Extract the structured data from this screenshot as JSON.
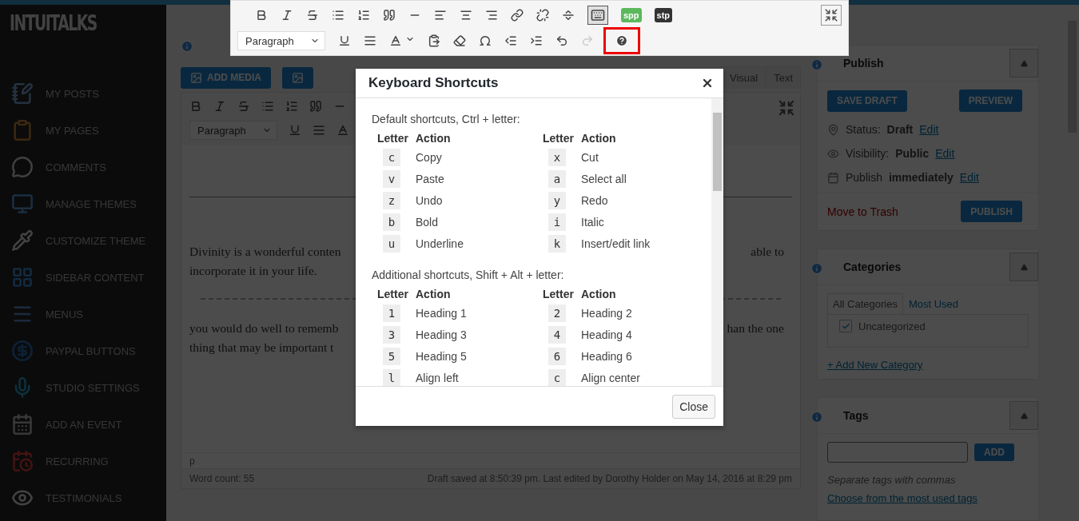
{
  "logo": "INTUITALKS",
  "sidebar": {
    "items": [
      {
        "label": "MY POSTS"
      },
      {
        "label": "MY PAGES"
      },
      {
        "label": "COMMENTS"
      },
      {
        "label": "MANAGE THEMES"
      },
      {
        "label": "CUSTOMIZE THEME"
      },
      {
        "label": "SIDEBAR CONTENT"
      },
      {
        "label": "MENUS"
      },
      {
        "label": "PAYPAL BUTTONS"
      },
      {
        "label": "STUDIO SETTINGS"
      },
      {
        "label": "ADD AN EVENT"
      },
      {
        "label": "RECURRING"
      },
      {
        "label": "TESTIMONIALS"
      }
    ]
  },
  "editor": {
    "add_media": "ADD MEDIA",
    "tabs": [
      {
        "label": "Visual"
      },
      {
        "label": "Text"
      }
    ],
    "format_select": "Paragraph",
    "paragraphs": [
      {
        "left": [
          "Divinity is a wonderful conten",
          "incorporate it in your life."
        ],
        "right": [
          "able to"
        ]
      },
      {
        "left": [
          "you would do well to rememb",
          "thing that may be important t"
        ],
        "right": [
          "han the one"
        ]
      }
    ],
    "path": "p",
    "word_count": "Word count: 55",
    "save_status": "Draft saved at 8:50:39 pm. Last edited by Dorothy Holder on May 14, 2016 at 8:29 pm"
  },
  "sticky_toolbar": {
    "toolbar_toggle": {
      "on": true
    },
    "plugins": [
      {
        "label": "spp",
        "color": "#5cb85c"
      },
      {
        "label": "stp",
        "color": "#333333"
      }
    ],
    "format_select": "Paragraph",
    "redo": {
      "disabled": true
    },
    "help": {
      "highlighted": true
    }
  },
  "publish": {
    "title": "Publish",
    "save_draft": "SAVE DRAFT",
    "preview": "PREVIEW",
    "rows": [
      {
        "kind": "status",
        "label": "Status:",
        "value": "Draft",
        "link": "Edit"
      },
      {
        "kind": "visibility",
        "label": "Visibility:",
        "value": "Public",
        "link": "Edit"
      },
      {
        "kind": "schedule",
        "label": "Publish",
        "value": "immediately",
        "link": "Edit"
      }
    ],
    "trash": "Move to Trash",
    "publish_button": "PUBLISH"
  },
  "categories": {
    "title": "Categories",
    "tabs": [
      {
        "label": "All Categories",
        "selected": true
      },
      {
        "label": "Most Used",
        "selected": false
      }
    ],
    "items": [
      {
        "label": "Uncategorized",
        "checked": true
      }
    ],
    "add_link": "+ Add New Category"
  },
  "tags": {
    "title": "Tags",
    "add_button": "ADD",
    "hint": "Separate tags with commas",
    "choose_link": "Choose from the most used tags"
  },
  "modal": {
    "title": "Keyboard Shortcuts",
    "sections": [
      {
        "heading": "Default shortcuts, Ctrl + letter:",
        "headers": [
          "Letter",
          "Action",
          "Letter",
          "Action"
        ],
        "rows": [
          [
            {
              "letter": "c",
              "action": "Copy"
            },
            {
              "letter": "x",
              "action": "Cut"
            }
          ],
          [
            {
              "letter": "v",
              "action": "Paste"
            },
            {
              "letter": "a",
              "action": "Select all"
            }
          ],
          [
            {
              "letter": "z",
              "action": "Undo"
            },
            {
              "letter": "y",
              "action": "Redo"
            }
          ],
          [
            {
              "letter": "b",
              "action": "Bold"
            },
            {
              "letter": "i",
              "action": "Italic"
            }
          ],
          [
            {
              "letter": "u",
              "action": "Underline"
            },
            {
              "letter": "k",
              "action": "Insert/edit link"
            }
          ]
        ]
      },
      {
        "heading": "Additional shortcuts, Shift + Alt + letter:",
        "headers": [
          "Letter",
          "Action",
          "Letter",
          "Action"
        ],
        "rows": [
          [
            {
              "letter": "1",
              "action": "Heading 1"
            },
            {
              "letter": "2",
              "action": "Heading 2"
            }
          ],
          [
            {
              "letter": "3",
              "action": "Heading 3"
            },
            {
              "letter": "4",
              "action": "Heading 4"
            }
          ],
          [
            {
              "letter": "5",
              "action": "Heading 5"
            },
            {
              "letter": "6",
              "action": "Heading 6"
            }
          ],
          [
            {
              "letter": "l",
              "action": "Align left"
            },
            {
              "letter": "c",
              "action": "Align center"
            }
          ]
        ]
      }
    ],
    "close_button": "Close"
  }
}
